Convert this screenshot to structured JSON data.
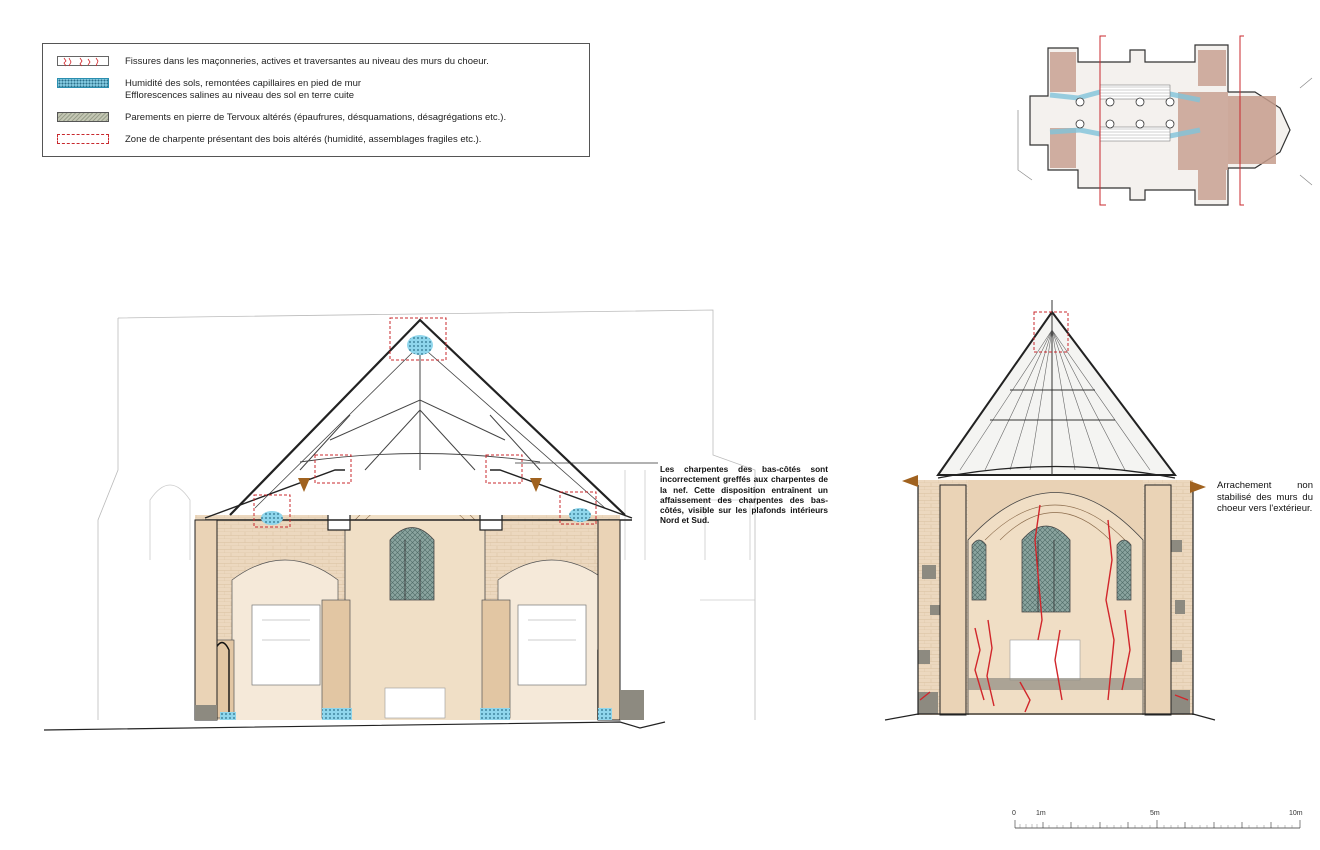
{
  "legend": {
    "items": [
      {
        "key": "cracks",
        "label": "Fissures dans les maçonneries, actives et traversantes au niveau des murs du choeur."
      },
      {
        "key": "humidity",
        "label": "Humidité des sols, remontées capillaires en pied de mur",
        "label2": "Efflorescences salines au niveau des sol en terre cuite"
      },
      {
        "key": "stone",
        "label": "Parements en pierre de Tervoux altérés (épaufrures, désquamations, désagrégations etc.)."
      },
      {
        "key": "frame",
        "label": "Zone de charpente présentant des bois altérés (humidité, assemblages fragiles etc.)."
      }
    ]
  },
  "annotations": {
    "nave_note": "Les charpentes des bas-côtés sont incorrectement greffés aux charpentes de la nef. Cette disposition entraînent un affaissement des charpentes des bas-côtés, visible sur les plafonds intérieurs Nord et Sud.",
    "choir_note": "Arrachement non stabilisé des murs du choeur vers l'extérieur."
  },
  "scale_bar": {
    "labels": [
      "0",
      "1m",
      "5m",
      "10m"
    ]
  },
  "colors": {
    "crack": "#d1262b",
    "humidity": "#6cc7e3",
    "stone_altered": "#9aa08c",
    "frame_zone": "#c8282d",
    "wall": "#ecd8bf",
    "arrow": "#a0621f"
  }
}
